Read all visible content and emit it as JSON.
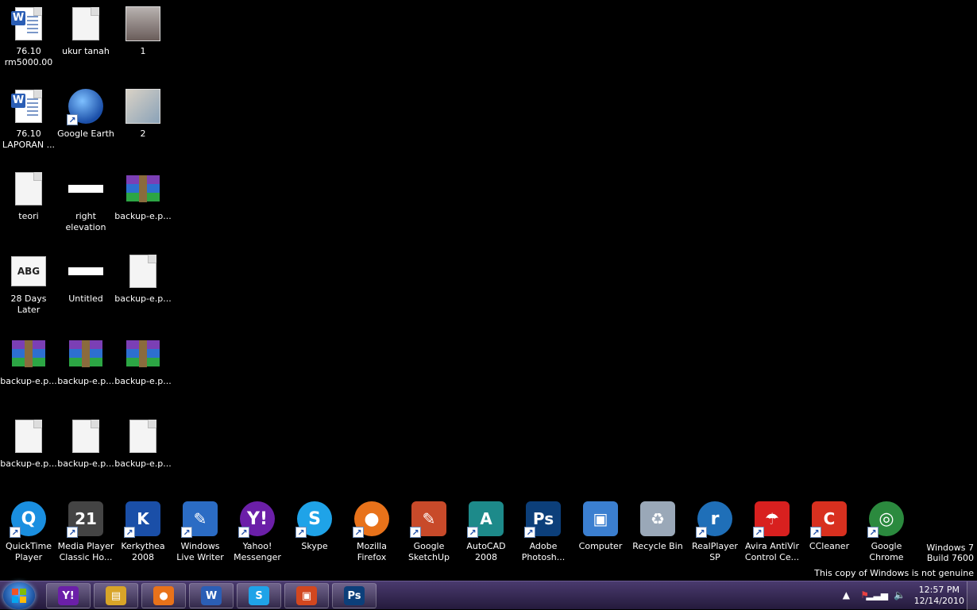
{
  "desktop_icons": [
    {
      "label": "76.10 rm5000.00",
      "icon": "word-document-icon"
    },
    {
      "label": "ukur tanah",
      "icon": "text-document-icon"
    },
    {
      "label": "1",
      "icon": "photo-icon"
    },
    {
      "label": "76.10 LAPORAN ...",
      "icon": "word-document-icon"
    },
    {
      "label": "Google Earth",
      "icon": "google-earth-icon"
    },
    {
      "label": "2",
      "icon": "photo-icon"
    },
    {
      "label": "teori",
      "icon": "text-document-icon"
    },
    {
      "label": "right elevation",
      "icon": "image-file-icon"
    },
    {
      "label": "backup-e.p...",
      "icon": "winrar-archive-icon"
    },
    {
      "label": "28 Days Later",
      "icon": "font-file-icon"
    },
    {
      "label": "Untitled",
      "icon": "image-file-icon"
    },
    {
      "label": "backup-e.p...",
      "icon": "blank-file-icon"
    },
    {
      "label": "backup-e.p...",
      "icon": "winrar-archive-icon"
    },
    {
      "label": "backup-e.p...",
      "icon": "winrar-archive-icon"
    },
    {
      "label": "backup-e.p...",
      "icon": "winrar-archive-icon"
    },
    {
      "label": "backup-e.p...",
      "icon": "blank-file-icon"
    },
    {
      "label": "backup-e.p...",
      "icon": "blank-file-icon"
    },
    {
      "label": "backup-e.p...",
      "icon": "blank-file-icon"
    }
  ],
  "bottom_icons": [
    {
      "label": "QuickTime Player",
      "icon": "quicktime-icon",
      "color": "#1a8fe0",
      "glyph": "Q"
    },
    {
      "label": "Media Player Classic Ho...",
      "icon": "media-player-classic-icon",
      "color": "#444444",
      "glyph": "21"
    },
    {
      "label": "Kerkythea 2008",
      "icon": "kerkythea-icon",
      "color": "#1a4fa8",
      "glyph": "K"
    },
    {
      "label": "Windows Live Writer",
      "icon": "live-writer-icon",
      "color": "#2b6cc4",
      "glyph": "✎"
    },
    {
      "label": "Yahoo! Messenger",
      "icon": "yahoo-messenger-icon",
      "color": "#6b1fa8",
      "glyph": "Y!"
    },
    {
      "label": "Skype",
      "icon": "skype-icon",
      "color": "#1fa3e8",
      "glyph": "S"
    },
    {
      "label": "Mozilla Firefox",
      "icon": "firefox-icon",
      "color": "#e8721a",
      "glyph": "●"
    },
    {
      "label": "Google SketchUp",
      "icon": "sketchup-icon",
      "color": "#c84a2a",
      "glyph": "✎"
    },
    {
      "label": "AutoCAD 2008",
      "icon": "autocad-icon",
      "color": "#1d8a8a",
      "glyph": "A"
    },
    {
      "label": "Adobe Photosh...",
      "icon": "photoshop-icon",
      "color": "#0c3f7a",
      "glyph": "Ps"
    },
    {
      "label": "Computer",
      "icon": "computer-icon",
      "color": "#3b7fd0",
      "glyph": "▣"
    },
    {
      "label": "Recycle Bin",
      "icon": "recycle-bin-icon",
      "color": "#9aa8b8",
      "glyph": "♻"
    },
    {
      "label": "RealPlayer SP",
      "icon": "realplayer-icon",
      "color": "#1f6fb8",
      "glyph": "r"
    },
    {
      "label": "Avira AntiVir Control Ce...",
      "icon": "avira-icon",
      "color": "#d8201f",
      "glyph": "☂"
    },
    {
      "label": "CCleaner",
      "icon": "ccleaner-icon",
      "color": "#d8301f",
      "glyph": "C"
    },
    {
      "label": "Google Chrome",
      "icon": "chrome-icon",
      "color": "#2b8a3e",
      "glyph": "◎"
    }
  ],
  "watermark": {
    "line1": "Windows 7",
    "line2": "Build 7600",
    "line3": "This copy of Windows is not genuine"
  },
  "taskbar": {
    "pinned": [
      {
        "icon": "yahoo-messenger-icon",
        "glyph": "Y!",
        "color": "#6b1fa8"
      },
      {
        "icon": "windows-explorer-icon",
        "glyph": "▤",
        "color": "#d8a428"
      },
      {
        "icon": "firefox-icon",
        "glyph": "●",
        "color": "#e8721a"
      },
      {
        "icon": "word-icon",
        "glyph": "W",
        "color": "#2b5eb5"
      },
      {
        "icon": "skype-icon",
        "glyph": "S",
        "color": "#1fa3e8"
      },
      {
        "icon": "powerpoint-icon",
        "glyph": "▣",
        "color": "#d2471f"
      },
      {
        "icon": "photoshop-icon",
        "glyph": "Ps",
        "color": "#0c3f7a"
      }
    ],
    "clock_time": "12:57 PM",
    "clock_date": "12/14/2010"
  }
}
